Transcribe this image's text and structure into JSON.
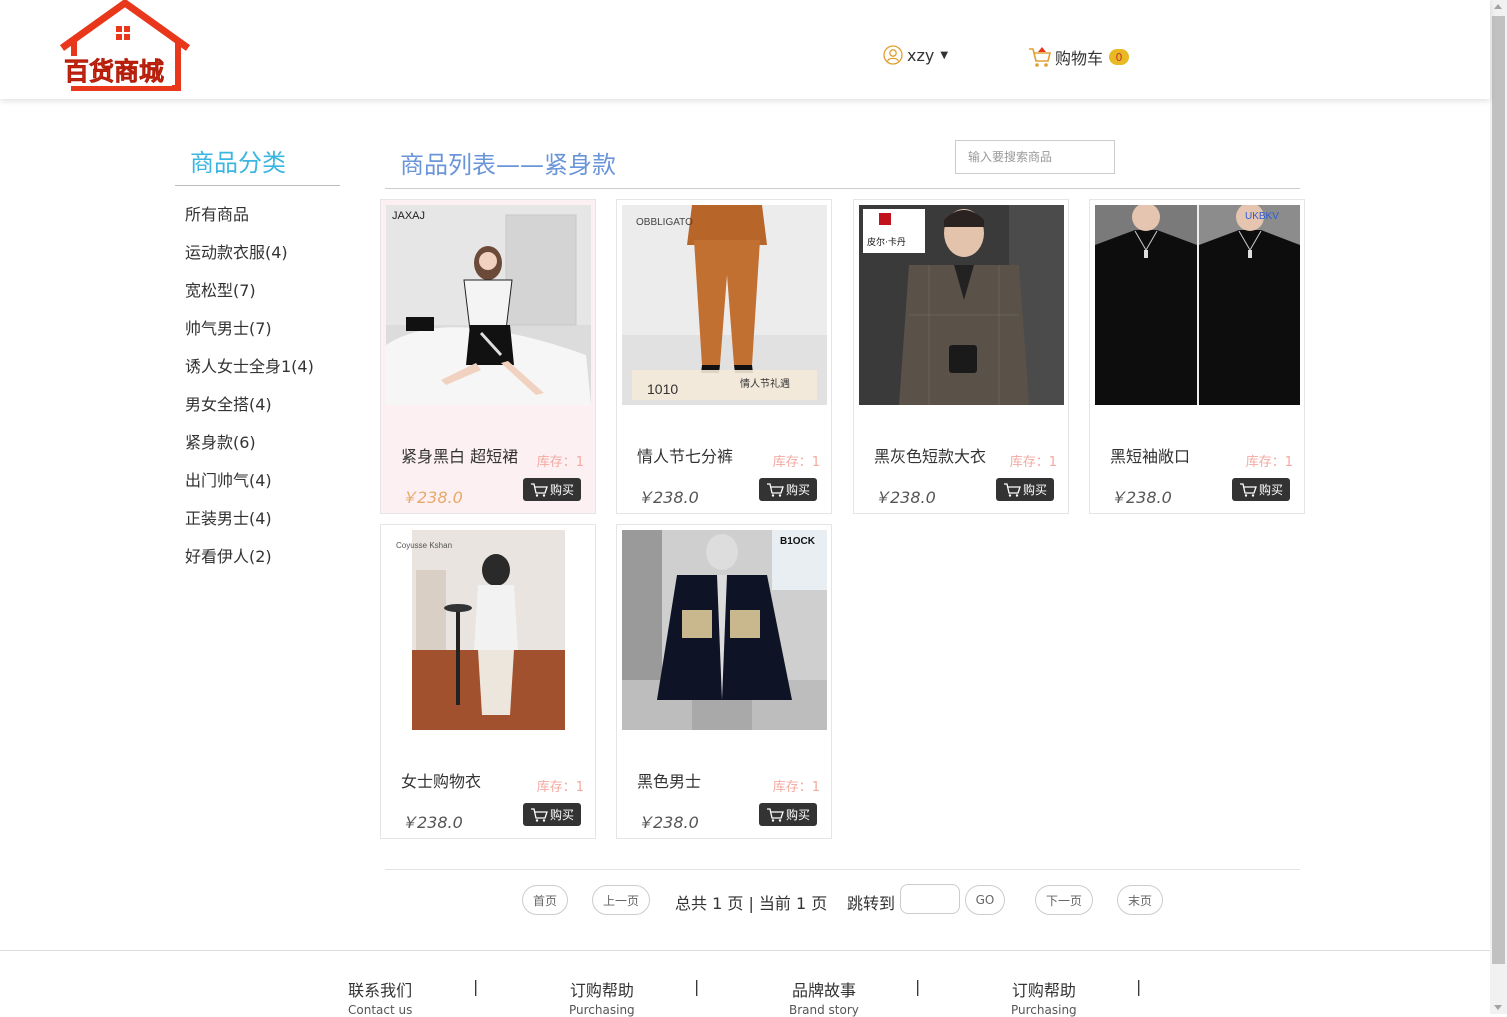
{
  "header": {
    "logo_text": "百货商城",
    "username": "xzy",
    "cart_label": "购物车",
    "cart_count": "0"
  },
  "sidebar": {
    "title": "商品分类",
    "items": [
      {
        "label": "所有商品"
      },
      {
        "label": "运动款衣服(4)"
      },
      {
        "label": "宽松型(7)"
      },
      {
        "label": "帅气男士(7)"
      },
      {
        "label": "诱人女士全身1(4)"
      },
      {
        "label": "男女全搭(4)"
      },
      {
        "label": "紧身款(6)"
      },
      {
        "label": "出门帅气(4)"
      },
      {
        "label": "正装男士(4)"
      },
      {
        "label": "好看伊人(2)"
      }
    ]
  },
  "main": {
    "title": "商品列表——紧身款",
    "search_placeholder": "输入要搜索商品",
    "products": [
      {
        "name": "紧身黑白 超短裙",
        "stock": "库存：1",
        "price": "￥238.0",
        "buy": "购买",
        "brand": "JAXAJ"
      },
      {
        "name": "情人节七分裤",
        "stock": "库存：1",
        "price": "￥238.0",
        "buy": "购买",
        "brand": "OBBLIGATO",
        "promo_price": "1010",
        "promo_text": "情人节礼遇"
      },
      {
        "name": "黑灰色短款大衣",
        "stock": "库存：1",
        "price": "￥238.0",
        "buy": "购买",
        "brand": "皮尔·卡丹"
      },
      {
        "name": "黑短袖敞口",
        "stock": "库存：1",
        "price": "￥238.0",
        "buy": "购买",
        "brand": "UKBKV"
      },
      {
        "name": "女士购物衣",
        "stock": "库存：1",
        "price": "￥238.0",
        "buy": "购买",
        "brand": "Coyusse Kshan"
      },
      {
        "name": "黑色男士",
        "stock": "库存：1",
        "price": "￥238.0",
        "buy": "购买",
        "brand": "B1OCK"
      }
    ]
  },
  "pagination": {
    "first": "首页",
    "prev": "上一页",
    "info": "总共 1 页 | 当前 1 页",
    "jump_label": "跳转到",
    "go": "GO",
    "next": "下一页",
    "last": "末页"
  },
  "footer": {
    "links": [
      {
        "zh": "联系我们",
        "en": "Contact us"
      },
      {
        "zh": "订购帮助",
        "en": "Purchasing"
      },
      {
        "zh": "品牌故事",
        "en": "Brand story"
      },
      {
        "zh": "订购帮助",
        "en": "Purchasing"
      }
    ],
    "separator": "|"
  },
  "colors": {
    "category_title": "#3bb6e0",
    "list_title": "#6a95d8",
    "stock": "#f4a9a0",
    "price_active": "#e8a86a",
    "buy_button": "#333333",
    "logo_red": "#e8371b",
    "badge": "#e8b923"
  }
}
